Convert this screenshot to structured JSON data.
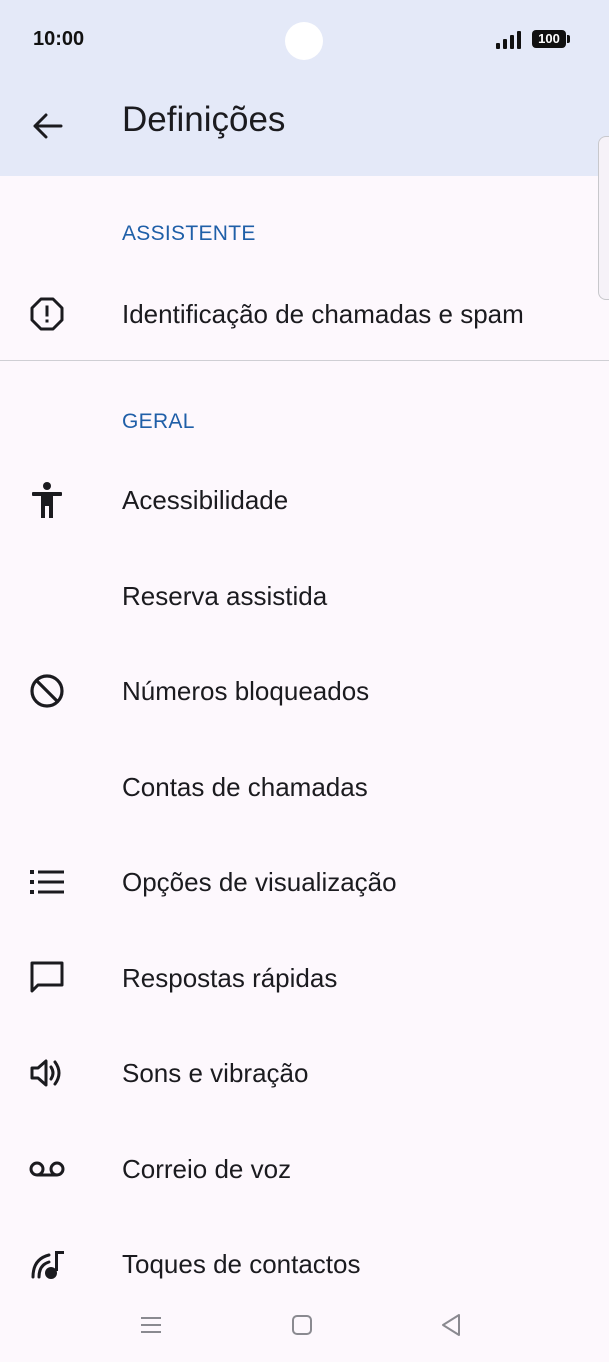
{
  "status": {
    "time": "10:00",
    "battery": "100"
  },
  "header": {
    "title": "Definições"
  },
  "sections": {
    "assistant": "ASSISTENTE",
    "general": "GERAL"
  },
  "items": {
    "caller_id": "Identificação de chamadas e spam",
    "accessibility": "Acessibilidade",
    "assisted_dialing": "Reserva assistida",
    "blocked_numbers": "Números bloqueados",
    "calling_accounts": "Contas de chamadas",
    "display_options": "Opções de visualização",
    "quick_responses": "Respostas rápidas",
    "sounds_vibration": "Sons e vibração",
    "voicemail": "Correio de voz",
    "contact_ringtones": "Toques de contactos"
  }
}
